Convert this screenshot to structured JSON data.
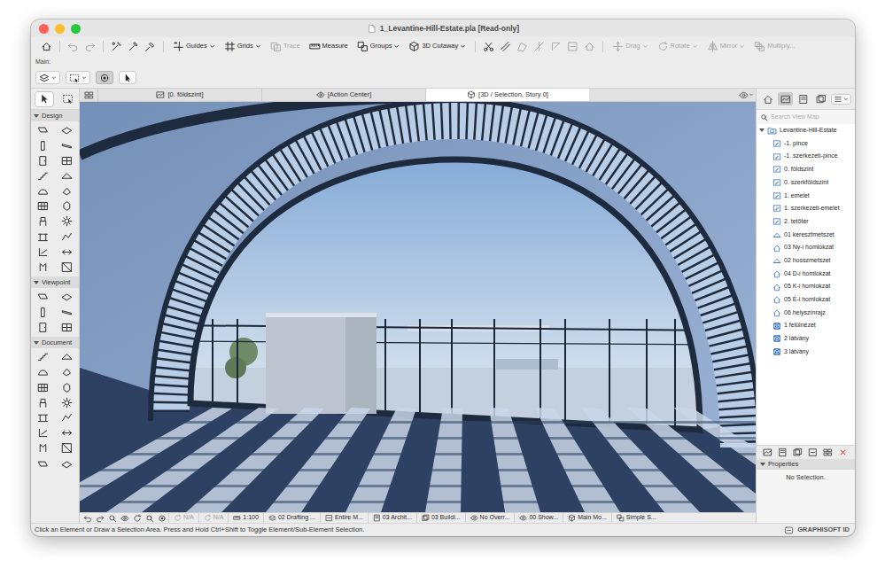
{
  "window": {
    "title": "1_Levantine-Hill-Estate.pla [Read-only]"
  },
  "toolbar": {
    "view_tools": [
      {
        "label": "Guides",
        "dropdown": true,
        "disabled": false
      },
      {
        "label": "Grids",
        "dropdown": true,
        "disabled": false
      },
      {
        "label": "Trace",
        "dropdown": false,
        "disabled": true
      },
      {
        "label": "Measure",
        "dropdown": false,
        "disabled": false
      },
      {
        "label": "Groups",
        "dropdown": true,
        "disabled": false
      },
      {
        "label": "3D Cutaway",
        "dropdown": true,
        "disabled": false
      }
    ],
    "edit_tools": [
      {
        "label": "Drag",
        "dropdown": true,
        "disabled": true
      },
      {
        "label": "Rotate",
        "dropdown": true,
        "disabled": true
      },
      {
        "label": "Mirror",
        "dropdown": true,
        "disabled": true
      },
      {
        "label": "Multiply...",
        "dropdown": false,
        "disabled": true
      }
    ]
  },
  "infobox": {
    "label": "Main:",
    "segments": [
      {
        "selected": false
      },
      {
        "selected": false
      },
      {
        "selected": true
      },
      {
        "selected": false
      }
    ]
  },
  "toolbox": {
    "tools": [
      {
        "selected": true
      },
      {
        "selected": false
      }
    ],
    "sections": [
      {
        "title": "Design",
        "expanded": true
      },
      {
        "title": "Viewpoint",
        "expanded": true
      },
      {
        "title": "Document",
        "expanded": true
      }
    ]
  },
  "tabs": [
    {
      "label": "[0. földszint]",
      "selected": false
    },
    {
      "label": "[Action Center]",
      "selected": false
    },
    {
      "label": "[3D / Selection, Story 0]",
      "selected": true
    }
  ],
  "navigator": {
    "views": [
      {
        "selected": false
      },
      {
        "selected": true
      },
      {
        "selected": false
      },
      {
        "selected": false
      }
    ],
    "search": {
      "placeholder": "Search View Map"
    },
    "root": {
      "label": "Levantine-Hill-Estate",
      "expanded": true
    },
    "items": [
      {
        "label": "-1. pince",
        "kind": "story"
      },
      {
        "label": "-1. szerkezeti-pince",
        "kind": "story"
      },
      {
        "label": "0. földszint",
        "kind": "story"
      },
      {
        "label": "0. szerkföldszint",
        "kind": "story"
      },
      {
        "label": "1. emelet",
        "kind": "story"
      },
      {
        "label": "1. szerkezeti-emelet",
        "kind": "story"
      },
      {
        "label": "2. tetőtér",
        "kind": "story"
      },
      {
        "label": "01 keresztmetszet",
        "kind": "section"
      },
      {
        "label": "03 Ny-i homlokzat",
        "kind": "elevation"
      },
      {
        "label": "02 hosszmetszet",
        "kind": "section"
      },
      {
        "label": "04 D-i homlokzat",
        "kind": "elevation"
      },
      {
        "label": "05 K-i homlokzat",
        "kind": "elevation"
      },
      {
        "label": "05 É-i homlokzat",
        "kind": "elevation"
      },
      {
        "label": "06 helyszínrajz",
        "kind": "elevation"
      },
      {
        "label": "1 felülnézet",
        "kind": "view3d"
      },
      {
        "label": "2 látvány",
        "kind": "view3d"
      },
      {
        "label": "3 látvány",
        "kind": "view3d"
      }
    ]
  },
  "properties": {
    "title": "Properties",
    "expanded": true,
    "message": "No Selection."
  },
  "status_bar": {
    "items": [
      {
        "label": "N/A",
        "disabled": true
      },
      {
        "label": "N/A",
        "disabled": true
      },
      {
        "label": "1:100",
        "disabled": false
      },
      {
        "label": "02 Drafting ...",
        "disabled": false
      },
      {
        "label": "Entire M...",
        "disabled": false
      },
      {
        "label": "03 Archit...",
        "disabled": false
      },
      {
        "label": "03 Buildi...",
        "disabled": false
      },
      {
        "label": "No Overr...",
        "disabled": false
      },
      {
        "label": "00 Show...",
        "disabled": false
      },
      {
        "label": "Main Mo...",
        "disabled": false
      },
      {
        "label": "Simple S...",
        "disabled": false
      }
    ]
  },
  "message": "Click an Element or Draw a Selection Area. Press and Hold Ctrl+Shift to Toggle Element/Sub-Element Selection.",
  "brand": {
    "label": "GRAPHISOFT ID"
  }
}
